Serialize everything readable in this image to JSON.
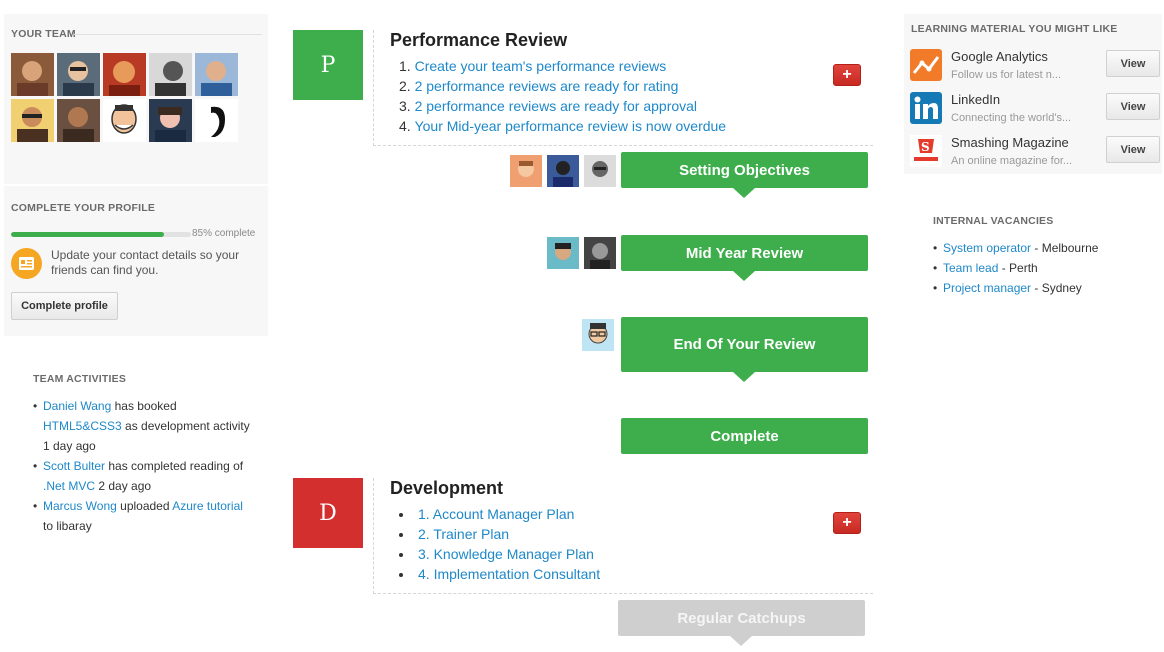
{
  "team": {
    "title": "YOUR TEAM",
    "avatars": [
      "team-member-1",
      "team-member-2",
      "team-member-3",
      "team-member-4",
      "team-member-5",
      "team-member-6",
      "team-member-7",
      "team-member-8",
      "team-member-9",
      "team-member-10"
    ]
  },
  "profile": {
    "title": "COMPLETE YOUR PROFILE",
    "progress": 0.85,
    "progress_label": "85% complete",
    "message": "Update your contact details so your friends can find you.",
    "button_label": "Complete profile",
    "icon": "contact-card-icon"
  },
  "activities": {
    "title": "TEAM ACTIVITIES",
    "items": [
      {
        "actor": "Daniel Wang",
        "text1": " has booked ",
        "object": "HTML5&CSS3",
        "text2": " as development activity",
        "time": "1 day ago"
      },
      {
        "actor": "Scott Bulter",
        "text1": " has completed reading of ",
        "object": ".Net MVC",
        "text2": " 2 day ago",
        "time": ""
      },
      {
        "actor": "Marcus Wong",
        "text1": " uploaded ",
        "object": "Azure tutorial",
        "text2": " to libaray",
        "time": ""
      }
    ]
  },
  "performance": {
    "letter": "P",
    "letter_color": "#3dae4b",
    "title": "Performance Review",
    "items": [
      "Create your team's performance reviews",
      "2 performance reviews are ready for rating",
      "2 performance reviews are ready for approval",
      "Your Mid-year performance review is now overdue"
    ],
    "add_icon": "plus-icon"
  },
  "stages": [
    {
      "label": "Setting Objectives",
      "state": "active"
    },
    {
      "label": "Mid Year Review",
      "state": "active"
    },
    {
      "label": "End Of Your Review",
      "state": "active"
    },
    {
      "label": "Complete",
      "state": "active"
    },
    {
      "label": "Regular Catchups",
      "state": "inactive"
    }
  ],
  "development": {
    "letter": "D",
    "letter_color": "#d32f2f",
    "title": "Development",
    "items": [
      "1. Account Manager Plan",
      "2. Trainer Plan",
      "3. Knowledge Manager Plan",
      "4. Implementation Consultant"
    ],
    "add_icon": "plus-icon"
  },
  "learning": {
    "title": "LEARNING MATERIAL YOU MIGHT LIKE",
    "items": [
      {
        "name": "Google Analytics",
        "desc": "Follow us for latest n...",
        "button": "View",
        "icon": "google-analytics-icon"
      },
      {
        "name": "LinkedIn",
        "desc": "Connecting the world's...",
        "button": "View",
        "icon": "linkedin-icon"
      },
      {
        "name": "Smashing Magazine",
        "desc": "An online magazine for...",
        "button": "View",
        "icon": "smashing-magazine-icon"
      }
    ]
  },
  "vacancies": {
    "title": "INTERNAL VACANCIES",
    "items": [
      {
        "role": "System operator",
        "location": " - Melbourne"
      },
      {
        "role": "Team lead",
        "location": " - Perth"
      },
      {
        "role": "Project manager",
        "location": " - Sydney"
      }
    ]
  },
  "colors": {
    "green": "#3dae4b",
    "red": "#d32f2f",
    "link": "#1e88c9",
    "gray_stage": "#cfcfcf"
  }
}
